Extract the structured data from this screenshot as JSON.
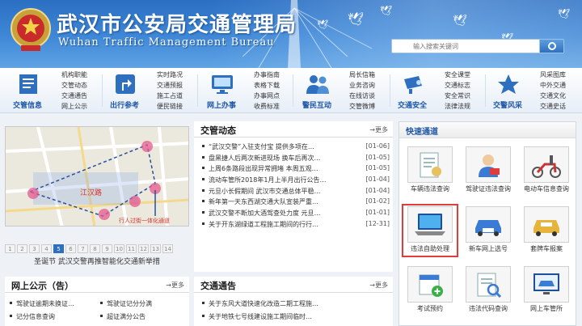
{
  "header": {
    "title_cn": "武汉市公安局交通管理局",
    "title_en": "Wuhan Traffic Management Bureau",
    "search_placeholder": "输入搜索关键词"
  },
  "nav": [
    {
      "label": "交管信息",
      "icon": "document-list-icon",
      "links": [
        "机构职能",
        "交管动态",
        "交通通告",
        "网上公示"
      ]
    },
    {
      "label": "出行参考",
      "icon": "turn-sign-icon",
      "links": [
        "实时路况",
        "交通预报",
        "施工占道",
        "便民链接"
      ]
    },
    {
      "label": "网上办事",
      "icon": "monitor-icon",
      "links": [
        "办事指南",
        "表格下载",
        "办事网点",
        "收费标准"
      ]
    },
    {
      "label": "警民互动",
      "icon": "people-icon",
      "links": [
        "局长信箱",
        "业务咨询",
        "在线访谈",
        "交管微博"
      ]
    },
    {
      "label": "交通安全",
      "icon": "camera-icon",
      "links": [
        "安全课堂",
        "交通标志",
        "安全常识",
        "法律法规"
      ]
    },
    {
      "label": "交警风采",
      "icon": "star-icon",
      "links": [
        "风采图库",
        "中外交通",
        "交通文化",
        "交通史话"
      ]
    }
  ],
  "slideshow": {
    "pages": [
      "1",
      "2",
      "3",
      "4",
      "5",
      "6",
      "7",
      "8",
      "9",
      "10",
      "11",
      "12",
      "13",
      "14"
    ],
    "active_page": "5",
    "caption": "圣诞节 武汉交警再推智能化交通新举措",
    "map_label_1": "江汉路",
    "map_label_2": "行人过街一体化通道"
  },
  "news": {
    "title": "交管动态",
    "more": "更多",
    "items": [
      {
        "text": "“武汉交警”入驻支付宝 提供多项在…",
        "date": "[01-06]"
      },
      {
        "text": "盘黑捷人后两次新进现场 换车后再次…",
        "date": "[01-05]"
      },
      {
        "text": "上周6条路段出现异常拥堵 本周五观…",
        "date": "[01-05]"
      },
      {
        "text": "流动车管所2018年1月上半月出行公告…",
        "date": "[01-04]"
      },
      {
        "text": "元旦小长假期间 武汉市交通总体平稳…",
        "date": "[01-04]"
      },
      {
        "text": "新年第一天东西湖交通大队宣装严重…",
        "date": "[01-02]"
      },
      {
        "text": "武汉交警不断加大酒驾查处力度 元旦…",
        "date": "[01-01]"
      },
      {
        "text": "关于开东湖绿道工程施工期间的行行…",
        "date": "[12-31]"
      }
    ]
  },
  "public": {
    "title": "网上公示（告）",
    "more": "更多",
    "items": [
      "驾驶证逾期未换证…",
      "驾驶证记分分满",
      "记分信息查询",
      "超证满分公告"
    ]
  },
  "notice": {
    "title": "交通通告",
    "more": "更多",
    "items": [
      "关于东风大道快速化改造二期工程施…",
      "关于地铁七号线建设施工期间临时…"
    ]
  },
  "services": {
    "title": "快速通道",
    "tiles": [
      {
        "label": "车辆违法查询",
        "icon": "document-icon"
      },
      {
        "label": "驾驶证违法查询",
        "icon": "person-id-icon"
      },
      {
        "label": "电动车信息查询",
        "icon": "scooter-icon"
      },
      {
        "label": "违法自助处理",
        "icon": "laptop-icon"
      },
      {
        "label": "新车网上选号",
        "icon": "car-plate-icon"
      },
      {
        "label": "套牌车报案",
        "icon": "car-alert-icon"
      },
      {
        "label": "考试预约",
        "icon": "calendar-plus-icon"
      },
      {
        "label": "违法代码查询",
        "icon": "search-document-icon"
      },
      {
        "label": "网上车管所",
        "icon": "screen-car-icon"
      }
    ]
  },
  "colors": {
    "brand_blue": "#2f6fbf",
    "highlight_red": "#e23b3b"
  }
}
